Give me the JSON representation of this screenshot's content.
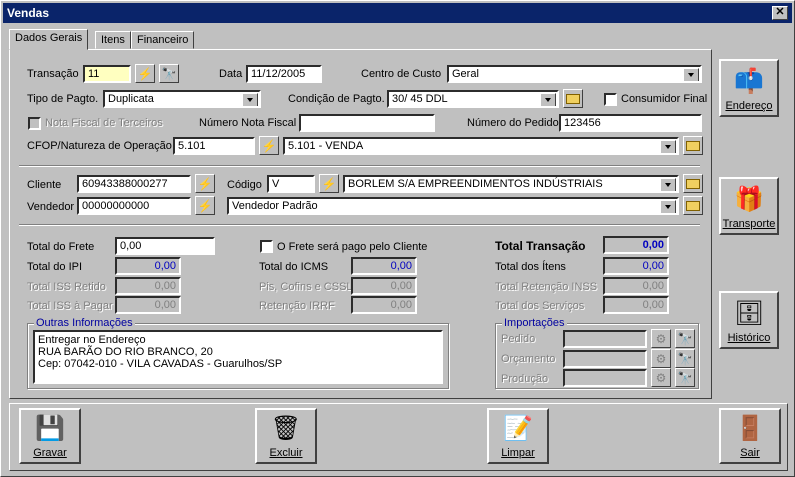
{
  "window": {
    "title": "Vendas",
    "close_label": "✕"
  },
  "tabs": [
    {
      "label": "Dados Gerais"
    },
    {
      "label": "Itens"
    },
    {
      "label": "Financeiro"
    }
  ],
  "fields": {
    "transacao_label": "Transação",
    "transacao_value": "11",
    "data_label": "Data",
    "data_value": "11/12/2005",
    "centro_custo_label": "Centro de Custo",
    "centro_custo_value": "Geral",
    "tipo_pagto_label": "Tipo de Pagto.",
    "tipo_pagto_value": "Duplicata",
    "condicao_pagto_label": "Condição de Pagto.",
    "condicao_pagto_value": "30/ 45 DDL",
    "consumidor_final_label": "Consumidor Final",
    "nf_terceiros_label": "Nota Fiscal de Terceiros",
    "numero_nf_label": "Número Nota Fiscal",
    "numero_nf_value": "",
    "numero_pedido_label": "Número do Pedido",
    "numero_pedido_value": "123456",
    "cfop_label": "CFOP/Natureza de Operação",
    "cfop_code": "5.101",
    "cfop_desc": "5.101 - VENDA",
    "cliente_label": "Cliente",
    "cliente_value": "60943388000277",
    "codigo_label": "Código",
    "codigo_value": "V",
    "cliente_nome": "BORLEM S/A EMPREENDIMENTOS INDÚSTRIAIS",
    "vendedor_label": "Vendedor",
    "vendedor_value": "00000000000",
    "vendedor_nome": "Vendedor Padrão"
  },
  "totals": {
    "frete_label": "Total do Frete",
    "frete_value": "0,00",
    "ipi_label": "Total do IPI",
    "ipi_value": "0,00",
    "iss_retido_label": "Total ISS Retido",
    "iss_retido_value": "0,00",
    "iss_pagar_label": "Total ISS à Pagar",
    "iss_pagar_value": "0,00",
    "frete_cliente_label": "O Frete será pago pelo Cliente",
    "icms_label": "Total do ICMS",
    "icms_value": "0,00",
    "pis_label": "Pis, Cofins e CSSL",
    "pis_value": "0,00",
    "irrf_label": "Retenção IRRF",
    "irrf_value": "0,00",
    "transacao_label": "Total Transação",
    "transacao_value": "0,00",
    "itens_label": "Total dos Ítens",
    "itens_value": "0,00",
    "inss_label": "Total Retenção INSS",
    "inss_value": "0,00",
    "servicos_label": "Total dos Serviços",
    "servicos_value": "0,00"
  },
  "outras": {
    "title": "Outras Informações",
    "line1": "Entregar no Endereço",
    "line2": "RUA BARÃO DO RIO BRANCO, 20",
    "line3": "Cep: 07042-010 - VILA CAVADAS - Guarulhos/SP"
  },
  "importacoes": {
    "title": "Importações",
    "pedido_label": "Pedido",
    "orcamento_label": "Orçamento",
    "producao_label": "Produção"
  },
  "side_buttons": {
    "endereco": "Endereço",
    "transporte": "Transporte",
    "historico": "Histórico"
  },
  "bottom_buttons": {
    "gravar": "Gravar",
    "excluir": "Excluir",
    "limpar": "Limpar",
    "sair": "Sair"
  },
  "colors": {
    "title_bar": "#0a246a",
    "face": "#c0c0c0",
    "value_blue": "#0000c0",
    "highlight_yellow": "#ffffc0"
  }
}
